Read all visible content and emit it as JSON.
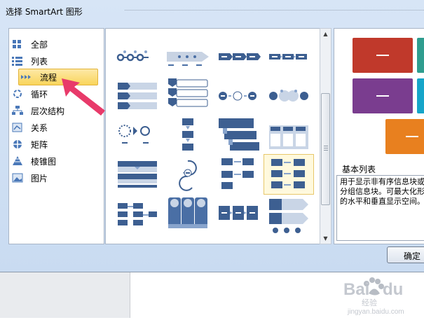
{
  "dialog": {
    "title": "选择 SmartArt 图形"
  },
  "categories": [
    {
      "label": "全部",
      "icon": "grid-icon"
    },
    {
      "label": "列表",
      "icon": "list-icon"
    },
    {
      "label": "流程",
      "icon": "process-icon",
      "selected": true
    },
    {
      "label": "循环",
      "icon": "cycle-icon"
    },
    {
      "label": "层次结构",
      "icon": "hierarchy-icon"
    },
    {
      "label": "关系",
      "icon": "relationship-icon"
    },
    {
      "label": "矩阵",
      "icon": "matrix-icon"
    },
    {
      "label": "棱锥图",
      "icon": "pyramid-icon"
    },
    {
      "label": "图片",
      "icon": "picture-icon"
    }
  ],
  "preview": {
    "title": "基本列表",
    "description": "用于显示非有序信息块或者分组信息块。可最大化形状的水平和垂直显示空间。",
    "swatch_colors": [
      "#c0392b",
      "#7a3d8f",
      "#16a5c9",
      "#e8801f",
      "#2f9d8f"
    ]
  },
  "buttons": {
    "ok": "确定"
  },
  "watermark": {
    "brand": "Bai du 经验",
    "url": "jingyan.baidu.com"
  },
  "colors": {
    "accent_arrow": "#e83a6a",
    "layout_blue": "#4a6fa5",
    "layout_light": "#c9d5e6"
  }
}
